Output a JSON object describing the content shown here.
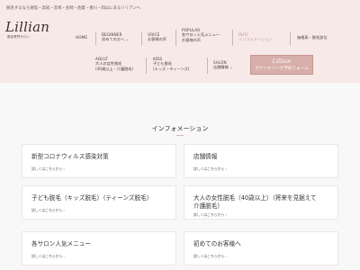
{
  "header": {
    "tagline": "脱毛するなら徳島・高知・宮崎・長崎・佐賀・香川・岡山にあるリリアンへ",
    "logo_script": "Lillian",
    "logo_sub": "脱毛専門サロン"
  },
  "nav": {
    "home": {
      "en": "HOME"
    },
    "beginner": {
      "en": "BEGINNER",
      "jp": "初めての方へ",
      "icon": "chevron-down-icon"
    },
    "voice": {
      "en": "VOICE",
      "jp": "お客様の声"
    },
    "popular": {
      "en": "POPULAR",
      "jp1": "各サロン人気メニュー",
      "jp2": "お客様の声"
    },
    "info": {
      "en": "INFO",
      "jp": "インフォメーション"
    },
    "price": {
      "jp": "価格表・脱毛部位"
    },
    "adult": {
      "en": "ADULT",
      "jp1": "大人の女性脱毛",
      "jp2": "(40歳以上・介護脱毛)"
    },
    "kids": {
      "en": "KIDS",
      "jp1": "子ども脱毛",
      "jp2": "(キッズ・ティーンズ)"
    },
    "salon": {
      "en": "SALON",
      "jp": "店舗情報",
      "icon": "chevron-down-icon"
    },
    "cta": {
      "script": "Lillian",
      "label": "カウンセリング予約フォーム"
    }
  },
  "section": {
    "title": "インフォメーション"
  },
  "cards": [
    {
      "title": "新型コロナウィルス感染対策",
      "more": "詳しくはこちらから ›"
    },
    {
      "title": "店舗情報",
      "more": "詳しくはこちらから ›"
    },
    {
      "title": "子ども脱毛（キッズ脱毛）（ティーンズ脱毛）",
      "more": "詳しくはこちらから ›"
    },
    {
      "title": "大人の女性脱毛（40歳以上）（将来を見据えて",
      "title2": "介護脱毛）",
      "more": "詳しくはこちらから ›"
    },
    {
      "title": "各サロン人気メニュー",
      "more": "詳しくはこちらから ›"
    },
    {
      "title": "初めてのお客様へ",
      "more": "詳しくはこちらから ›"
    }
  ],
  "colors": {
    "header_bg": "#f6e9e8",
    "accent": "#d8aeaa",
    "active": "#c79794"
  }
}
